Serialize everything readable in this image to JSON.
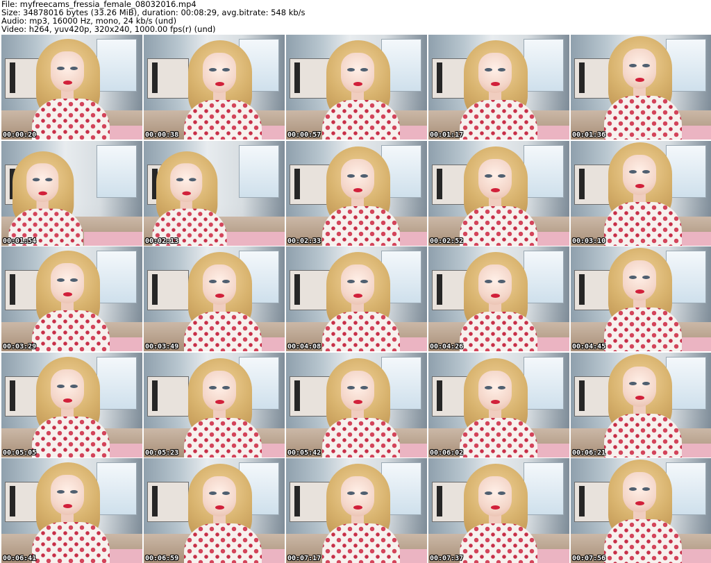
{
  "header": {
    "file_line": "File: myfreecams_fressia_female_08032016.mp4",
    "size_line": "Size: 34878016 bytes (33.26 MiB), duration: 00:08:29, avg.bitrate: 548 kb/s",
    "audio_line": "Audio: mp3, 16000 Hz, mono, 24 kb/s (und)",
    "video_line": "Video: h264, yuv420p, 320x240, 1000.00 fps(r) (und)"
  },
  "thumbnails": [
    {
      "timestamp": "00:00:20"
    },
    {
      "timestamp": "00:00:38"
    },
    {
      "timestamp": "00:00:57"
    },
    {
      "timestamp": "00:01:17"
    },
    {
      "timestamp": "00:01:36"
    },
    {
      "timestamp": "00:01:54"
    },
    {
      "timestamp": "00:02:13"
    },
    {
      "timestamp": "00:02:33"
    },
    {
      "timestamp": "00:02:52"
    },
    {
      "timestamp": "00:03:10"
    },
    {
      "timestamp": "00:03:29"
    },
    {
      "timestamp": "00:03:49"
    },
    {
      "timestamp": "00:04:08"
    },
    {
      "timestamp": "00:04:26"
    },
    {
      "timestamp": "00:04:45"
    },
    {
      "timestamp": "00:05:05"
    },
    {
      "timestamp": "00:05:23"
    },
    {
      "timestamp": "00:05:42"
    },
    {
      "timestamp": "00:06:02"
    },
    {
      "timestamp": "00:06:21"
    },
    {
      "timestamp": "00:06:41"
    },
    {
      "timestamp": "00:06:59"
    },
    {
      "timestamp": "00:07:17"
    },
    {
      "timestamp": "00:07:37"
    },
    {
      "timestamp": "00:07:56"
    }
  ]
}
